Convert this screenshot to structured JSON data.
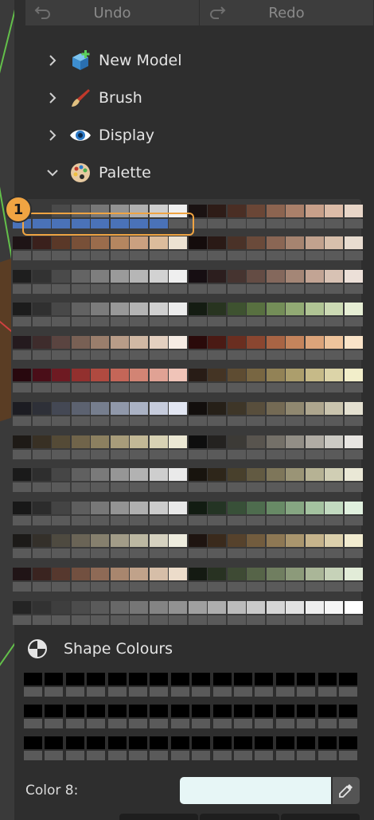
{
  "toolbar": {
    "undo_label": "Undo",
    "redo_label": "Redo"
  },
  "tree": [
    {
      "label": "New Model",
      "icon": "cube-add-icon",
      "expanded": false
    },
    {
      "label": "Brush",
      "icon": "brush-icon",
      "expanded": false
    },
    {
      "label": "Display",
      "icon": "eye-icon",
      "expanded": false
    },
    {
      "label": "Palette",
      "icon": "palette-icon",
      "expanded": true
    }
  ],
  "callout": {
    "number": "1"
  },
  "palette": {
    "selected_color": "#4a72b8",
    "rows": [
      [
        "#2a2a2a",
        "#3a3a3a",
        "#4a4a4a",
        "#5e5e5e",
        "#777777",
        "#939393",
        "#b0b0b0",
        "#cfcfcf",
        "#f0f0f0",
        "#1a1212",
        "#2e1c17",
        "#4a2e24",
        "#6a4636",
        "#8c6450",
        "#aa806a",
        "#c8a08a",
        "#dcbca8",
        "#e8d6c8"
      ],
      [
        "#1e1416",
        "#3a201c",
        "#5a3828",
        "#785038",
        "#9a6c4c",
        "#b48660",
        "#caa080",
        "#dcbc9c",
        "#ece2d2",
        "#140c0c",
        "#2a1a16",
        "#4a3228",
        "#6a4a3a",
        "#8a6654",
        "#a68470",
        "#c2a28e",
        "#d8c0ac",
        "#e8dcd0"
      ],
      [
        "#1e1e1e",
        "#323232",
        "#4a4a4a",
        "#646464",
        "#7e7e7e",
        "#9a9a9a",
        "#b6b6b6",
        "#d2d2d2",
        "#efefef",
        "#160e12",
        "#2c1e1e",
        "#463430",
        "#644c44",
        "#84685c",
        "#a48676",
        "#c2a494",
        "#d8c2b4",
        "#ece0d8"
      ],
      [
        "#1c1c1c",
        "#303030",
        "#484848",
        "#626262",
        "#7c7c7c",
        "#989898",
        "#b4b4b4",
        "#d0d0d0",
        "#ececec",
        "#141c12",
        "#283420",
        "#3e5230",
        "#587040",
        "#748e58",
        "#92aa74",
        "#b0c494",
        "#ccdab4",
        "#e6eed4"
      ],
      [
        "#241a1e",
        "#3e2c2c",
        "#5a4440",
        "#786054",
        "#9a7e6c",
        "#b89c88",
        "#d0b8a4",
        "#e4d0c0",
        "#f6ece4",
        "#2a0a0a",
        "#4a1a14",
        "#6a2e20",
        "#8a4630",
        "#a86444",
        "#c4845c",
        "#dca47a",
        "#eec49c",
        "#fae4c8"
      ],
      [
        "#28080e",
        "#4a0e18",
        "#6e1a22",
        "#92302e",
        "#b04a40",
        "#c46658",
        "#d28474",
        "#e0a294",
        "#f0c4b8",
        "#281c16",
        "#443424",
        "#5e4c32",
        "#786642",
        "#928256",
        "#ac9e6c",
        "#c6ba88",
        "#dcd4a8",
        "#f2eeca"
      ],
      [
        "#1c1c22",
        "#2e3038",
        "#444854",
        "#5c6270",
        "#767e8e",
        "#9098aa",
        "#aab2c4",
        "#c6ccdc",
        "#e2e6f2",
        "#120e0c",
        "#262018",
        "#3e3628",
        "#584e3c",
        "#746a54",
        "#908870",
        "#aea68e",
        "#cac4ae",
        "#e4e0d0"
      ],
      [
        "#1e1a16",
        "#383024",
        "#544a36",
        "#70644a",
        "#8c8060",
        "#a89c7a",
        "#c2b896",
        "#d8d2b4",
        "#ece8d4",
        "#0e0e0e",
        "#242220",
        "#3c3a36",
        "#58544e",
        "#747068",
        "#928e86",
        "#b0aca4",
        "#cccac4",
        "#e8e6e2"
      ],
      [
        "#1a1a1a",
        "#2e2e2e",
        "#464646",
        "#606060",
        "#7a7a7a",
        "#969696",
        "#b2b2b2",
        "#cecece",
        "#eaeaea",
        "#18140e",
        "#2e261a",
        "#48402c",
        "#625a42",
        "#7e765a",
        "#9a9476",
        "#b6b294",
        "#d0ceb4",
        "#eae8d6"
      ],
      [
        "#181818",
        "#2c2c2c",
        "#444444",
        "#5e5e5e",
        "#787878",
        "#949494",
        "#b0b0b0",
        "#cccccc",
        "#e8e8e8",
        "#121c12",
        "#243424",
        "#385038",
        "#4e6c4e",
        "#688a66",
        "#86a682",
        "#a4c2a0",
        "#c2dac0",
        "#e0f0de"
      ],
      [
        "#1c1a18",
        "#34302a",
        "#4e4a40",
        "#6a6456",
        "#86806e",
        "#a29c88",
        "#bcb8a2",
        "#d6d2c0",
        "#eeecde",
        "#1e1410",
        "#3a2a1c",
        "#56422c",
        "#725c3e",
        "#8e7854",
        "#aa966e",
        "#c6b48c",
        "#dcd0ac",
        "#f2ecd0"
      ],
      [
        "#201416",
        "#3a2420",
        "#56382e",
        "#725040",
        "#8e6a56",
        "#a8866e",
        "#c0a28a",
        "#d6bea8",
        "#ecdcca",
        "#141a12",
        "#283222",
        "#3e4a34",
        "#566448",
        "#707e60",
        "#8c9a7a",
        "#aab698",
        "#c6d2b8",
        "#e2ecd8"
      ],
      [
        "#242424",
        "#323232",
        "#3e3e3e",
        "#4c4c4c",
        "#5a5a5a",
        "#686868",
        "#767676",
        "#848484",
        "#929292",
        "#a0a0a0",
        "#aeaeae",
        "#bcbcbc",
        "#cacaca",
        "#d6d6d6",
        "#e2e2e2",
        "#eeeeee",
        "#f6f6f6",
        "#ffffff"
      ]
    ]
  },
  "shape_colours": {
    "label": "Shape Colours",
    "icon": "shape-colours-icon",
    "rows": 3,
    "cols": 16,
    "color": "#000000"
  },
  "color_field": {
    "label": "Color 8:",
    "value_color": "#e7f6f6"
  },
  "icons": {
    "picker": "eyedropper-icon",
    "undo": "undo-icon",
    "redo": "redo-icon"
  }
}
